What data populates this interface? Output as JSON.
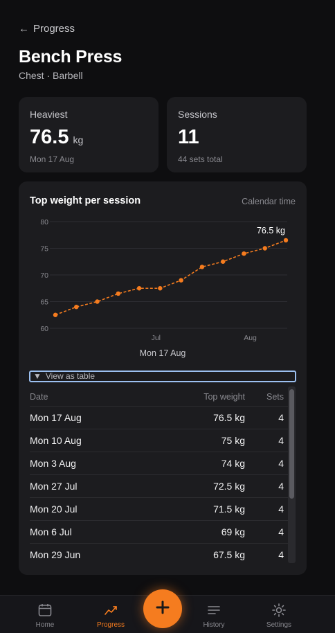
{
  "header": {
    "back_label": "Progress",
    "title": "Bench Press",
    "subtitle": "Chest · Barbell"
  },
  "stats": {
    "heaviest": {
      "label": "Heaviest",
      "value": "76.5",
      "unit": "kg",
      "note": "Mon 17 Aug"
    },
    "sessions": {
      "label": "Sessions",
      "value": "11",
      "note": "44 sets total"
    }
  },
  "chart_card": {
    "title": "Top weight per session",
    "mode": "Calendar time",
    "caption": "Mon 17 Aug",
    "last_label": "76.5 kg"
  },
  "chart_data": {
    "type": "line",
    "title": "Top weight per session",
    "x": [
      "2026-05-25",
      "2026-06-01",
      "2026-06-08",
      "2026-06-15",
      "2026-06-22",
      "2026-06-29",
      "2026-07-06",
      "2026-07-20",
      "2026-07-27",
      "2026-08-03",
      "2026-08-10",
      "2026-08-17"
    ],
    "values": [
      62.5,
      64,
      65,
      66.5,
      67.5,
      69,
      71.5,
      72.5,
      74,
      75,
      76.5
    ],
    "series": [
      {
        "points": [
          {
            "x": "May 26",
            "y": 62.5
          },
          {
            "x": "Jun 2",
            "y": 64
          },
          {
            "x": "Jun 9",
            "y": 65
          },
          {
            "x": "Jun 16",
            "y": 66.5
          },
          {
            "x": "Jun 23",
            "y": 67.5
          },
          {
            "x": "Mon 29 Jun",
            "y": 67.5
          },
          {
            "x": "Mon 6 Jul",
            "y": 69
          },
          {
            "x": "Mon 20 Jul",
            "y": 71.5
          },
          {
            "x": "Mon 27 Jul",
            "y": 72.5
          },
          {
            "x": "Mon 3 Aug",
            "y": 74
          },
          {
            "x": "Mon 10 Aug",
            "y": 75
          },
          {
            "x": "Mon 17 Aug",
            "y": 76.5
          }
        ]
      }
    ],
    "x_ticks": [
      "Jul",
      "Aug"
    ],
    "y_ticks": [
      60,
      65,
      70,
      75,
      80
    ],
    "ylim": [
      60,
      80
    ],
    "grid": true,
    "color": "#f57c1f"
  },
  "table": {
    "toggle_label": "View as table",
    "toggle_icon": "triangle-down-icon",
    "headers": {
      "date": "Date",
      "weight": "Top weight",
      "sets": "Sets"
    },
    "rows": [
      {
        "date": "Mon 17 Aug",
        "weight": "76.5 kg",
        "sets": "4"
      },
      {
        "date": "Mon 10 Aug",
        "weight": "75 kg",
        "sets": "4"
      },
      {
        "date": "Mon 3 Aug",
        "weight": "74 kg",
        "sets": "4"
      },
      {
        "date": "Mon 27 Jul",
        "weight": "72.5 kg",
        "sets": "4"
      },
      {
        "date": "Mon 20 Jul",
        "weight": "71.5 kg",
        "sets": "4"
      },
      {
        "date": "Mon 6 Jul",
        "weight": "69 kg",
        "sets": "4"
      },
      {
        "date": "Mon 29 Jun",
        "weight": "67.5 kg",
        "sets": "4"
      }
    ]
  },
  "nav": {
    "home": {
      "label": "Home",
      "icon": "calendar-icon"
    },
    "progress": {
      "label": "Progress",
      "icon": "trend-icon"
    },
    "add": {
      "icon": "plus-icon"
    },
    "history": {
      "label": "History",
      "icon": "list-icon"
    },
    "settings": {
      "label": "Settings",
      "icon": "gear-icon"
    }
  },
  "colors": {
    "accent": "#f57c1f",
    "background": "#0e0e10",
    "card": "#1c1c1f"
  }
}
